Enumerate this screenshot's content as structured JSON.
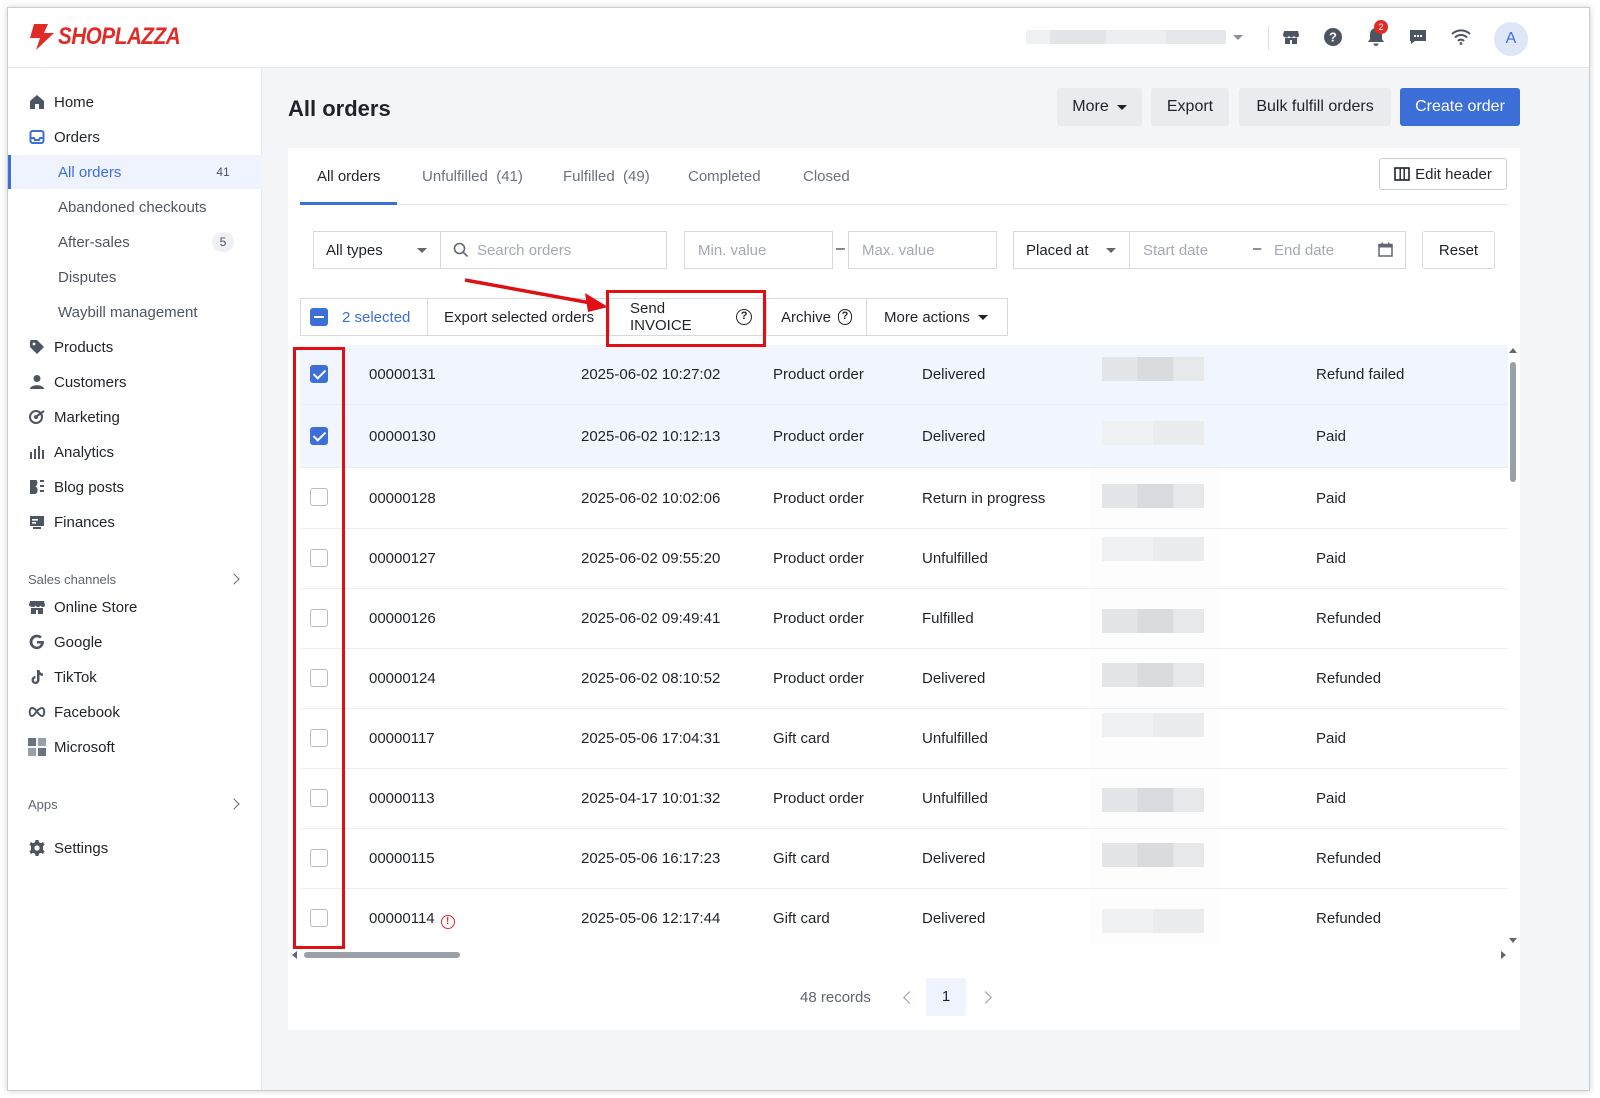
{
  "brand": {
    "name": "SHOPLAZZA",
    "color": "#e02b27"
  },
  "topbar": {
    "icons": [
      "store-icon",
      "help-icon",
      "bell-icon",
      "chat-icon",
      "wifi-icon"
    ],
    "notification_count": "2",
    "avatar_initial": "A"
  },
  "sidebar": {
    "items": {
      "home": "Home",
      "orders": "Orders",
      "products": "Products",
      "customers": "Customers",
      "marketing": "Marketing",
      "analytics": "Analytics",
      "blog": "Blog posts",
      "finances": "Finances",
      "online_store": "Online Store",
      "google": "Google",
      "tiktok": "TikTok",
      "facebook": "Facebook",
      "microsoft": "Microsoft",
      "settings": "Settings"
    },
    "orders_sub": {
      "all_orders": "All orders",
      "all_orders_count": "41",
      "abandoned": "Abandoned checkouts",
      "after_sales": "After-sales",
      "after_sales_count": "5",
      "disputes": "Disputes",
      "waybill": "Waybill management"
    },
    "sections": {
      "sales_channels": "Sales channels",
      "apps": "Apps"
    }
  },
  "header": {
    "title": "All orders",
    "more": "More",
    "export": "Export",
    "bulk_fulfill": "Bulk fulfill orders",
    "create_order": "Create order"
  },
  "tabs": {
    "all": "All orders",
    "unfulfilled": "Unfulfilled  (41)",
    "fulfilled": "Fulfilled  (49)",
    "completed": "Completed",
    "closed": "Closed",
    "edit_header": "Edit header"
  },
  "filters": {
    "type": "All types",
    "search_placeholder": "Search orders",
    "min_placeholder": "Min. value",
    "max_placeholder": "Max. value",
    "date_field": "Placed at",
    "start_placeholder": "Start date",
    "end_placeholder": "End date",
    "reset": "Reset"
  },
  "bulk": {
    "selected": "2 selected",
    "export_selected": "Export selected orders",
    "send_invoice": "Send INVOICE",
    "archive": "Archive",
    "more_actions": "More actions"
  },
  "orders": [
    {
      "id": "00000131",
      "date": "2025-06-02 10:27:02",
      "type": "Product order",
      "status": "Delivered",
      "payment": "Refund failed",
      "checked": true
    },
    {
      "id": "00000130",
      "date": "2025-06-02 10:12:13",
      "type": "Product order",
      "status": "Delivered",
      "payment": "Paid",
      "checked": true
    },
    {
      "id": "00000128",
      "date": "2025-06-02 10:02:06",
      "type": "Product order",
      "status": "Return in progress",
      "payment": "Paid",
      "checked": false
    },
    {
      "id": "00000127",
      "date": "2025-06-02 09:55:20",
      "type": "Product order",
      "status": "Unfulfilled",
      "payment": "Paid",
      "checked": false
    },
    {
      "id": "00000126",
      "date": "2025-06-02 09:49:41",
      "type": "Product order",
      "status": "Fulfilled",
      "payment": "Refunded",
      "checked": false
    },
    {
      "id": "00000124",
      "date": "2025-06-02 08:10:52",
      "type": "Product order",
      "status": "Delivered",
      "payment": "Refunded",
      "checked": false
    },
    {
      "id": "00000117",
      "date": "2025-05-06 17:04:31",
      "type": "Gift card",
      "status": "Unfulfilled",
      "payment": "Paid",
      "checked": false
    },
    {
      "id": "00000113",
      "date": "2025-04-17 10:01:32",
      "type": "Product order",
      "status": "Unfulfilled",
      "payment": "Paid",
      "checked": false
    },
    {
      "id": "00000115",
      "date": "2025-05-06 16:17:23",
      "type": "Gift card",
      "status": "Delivered",
      "payment": "Refunded",
      "checked": false
    },
    {
      "id": "00000114",
      "date": "2025-05-06 12:17:44",
      "type": "Gift card",
      "status": "Delivered",
      "payment": "Refunded",
      "checked": false,
      "warning": true
    }
  ],
  "pagination": {
    "records": "48 records",
    "page": "1"
  },
  "colors": {
    "accent": "#3d6fd9",
    "annotation": "#e00f14"
  }
}
